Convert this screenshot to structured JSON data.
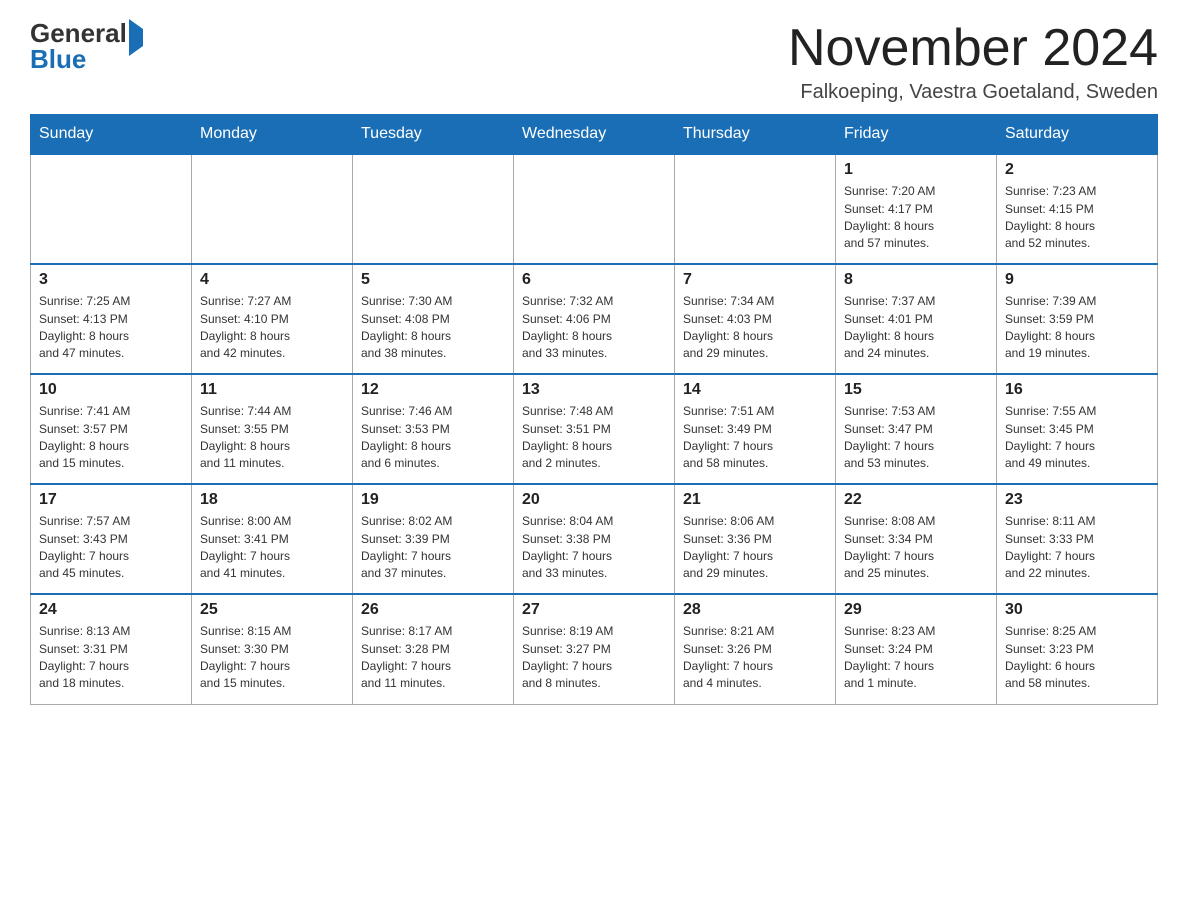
{
  "logo": {
    "general": "General",
    "blue": "Blue"
  },
  "header": {
    "month_year": "November 2024",
    "location": "Falkoeping, Vaestra Goetaland, Sweden"
  },
  "days_of_week": [
    "Sunday",
    "Monday",
    "Tuesday",
    "Wednesday",
    "Thursday",
    "Friday",
    "Saturday"
  ],
  "weeks": [
    [
      {
        "day": "",
        "info": ""
      },
      {
        "day": "",
        "info": ""
      },
      {
        "day": "",
        "info": ""
      },
      {
        "day": "",
        "info": ""
      },
      {
        "day": "",
        "info": ""
      },
      {
        "day": "1",
        "info": "Sunrise: 7:20 AM\nSunset: 4:17 PM\nDaylight: 8 hours\nand 57 minutes."
      },
      {
        "day": "2",
        "info": "Sunrise: 7:23 AM\nSunset: 4:15 PM\nDaylight: 8 hours\nand 52 minutes."
      }
    ],
    [
      {
        "day": "3",
        "info": "Sunrise: 7:25 AM\nSunset: 4:13 PM\nDaylight: 8 hours\nand 47 minutes."
      },
      {
        "day": "4",
        "info": "Sunrise: 7:27 AM\nSunset: 4:10 PM\nDaylight: 8 hours\nand 42 minutes."
      },
      {
        "day": "5",
        "info": "Sunrise: 7:30 AM\nSunset: 4:08 PM\nDaylight: 8 hours\nand 38 minutes."
      },
      {
        "day": "6",
        "info": "Sunrise: 7:32 AM\nSunset: 4:06 PM\nDaylight: 8 hours\nand 33 minutes."
      },
      {
        "day": "7",
        "info": "Sunrise: 7:34 AM\nSunset: 4:03 PM\nDaylight: 8 hours\nand 29 minutes."
      },
      {
        "day": "8",
        "info": "Sunrise: 7:37 AM\nSunset: 4:01 PM\nDaylight: 8 hours\nand 24 minutes."
      },
      {
        "day": "9",
        "info": "Sunrise: 7:39 AM\nSunset: 3:59 PM\nDaylight: 8 hours\nand 19 minutes."
      }
    ],
    [
      {
        "day": "10",
        "info": "Sunrise: 7:41 AM\nSunset: 3:57 PM\nDaylight: 8 hours\nand 15 minutes."
      },
      {
        "day": "11",
        "info": "Sunrise: 7:44 AM\nSunset: 3:55 PM\nDaylight: 8 hours\nand 11 minutes."
      },
      {
        "day": "12",
        "info": "Sunrise: 7:46 AM\nSunset: 3:53 PM\nDaylight: 8 hours\nand 6 minutes."
      },
      {
        "day": "13",
        "info": "Sunrise: 7:48 AM\nSunset: 3:51 PM\nDaylight: 8 hours\nand 2 minutes."
      },
      {
        "day": "14",
        "info": "Sunrise: 7:51 AM\nSunset: 3:49 PM\nDaylight: 7 hours\nand 58 minutes."
      },
      {
        "day": "15",
        "info": "Sunrise: 7:53 AM\nSunset: 3:47 PM\nDaylight: 7 hours\nand 53 minutes."
      },
      {
        "day": "16",
        "info": "Sunrise: 7:55 AM\nSunset: 3:45 PM\nDaylight: 7 hours\nand 49 minutes."
      }
    ],
    [
      {
        "day": "17",
        "info": "Sunrise: 7:57 AM\nSunset: 3:43 PM\nDaylight: 7 hours\nand 45 minutes."
      },
      {
        "day": "18",
        "info": "Sunrise: 8:00 AM\nSunset: 3:41 PM\nDaylight: 7 hours\nand 41 minutes."
      },
      {
        "day": "19",
        "info": "Sunrise: 8:02 AM\nSunset: 3:39 PM\nDaylight: 7 hours\nand 37 minutes."
      },
      {
        "day": "20",
        "info": "Sunrise: 8:04 AM\nSunset: 3:38 PM\nDaylight: 7 hours\nand 33 minutes."
      },
      {
        "day": "21",
        "info": "Sunrise: 8:06 AM\nSunset: 3:36 PM\nDaylight: 7 hours\nand 29 minutes."
      },
      {
        "day": "22",
        "info": "Sunrise: 8:08 AM\nSunset: 3:34 PM\nDaylight: 7 hours\nand 25 minutes."
      },
      {
        "day": "23",
        "info": "Sunrise: 8:11 AM\nSunset: 3:33 PM\nDaylight: 7 hours\nand 22 minutes."
      }
    ],
    [
      {
        "day": "24",
        "info": "Sunrise: 8:13 AM\nSunset: 3:31 PM\nDaylight: 7 hours\nand 18 minutes."
      },
      {
        "day": "25",
        "info": "Sunrise: 8:15 AM\nSunset: 3:30 PM\nDaylight: 7 hours\nand 15 minutes."
      },
      {
        "day": "26",
        "info": "Sunrise: 8:17 AM\nSunset: 3:28 PM\nDaylight: 7 hours\nand 11 minutes."
      },
      {
        "day": "27",
        "info": "Sunrise: 8:19 AM\nSunset: 3:27 PM\nDaylight: 7 hours\nand 8 minutes."
      },
      {
        "day": "28",
        "info": "Sunrise: 8:21 AM\nSunset: 3:26 PM\nDaylight: 7 hours\nand 4 minutes."
      },
      {
        "day": "29",
        "info": "Sunrise: 8:23 AM\nSunset: 3:24 PM\nDaylight: 7 hours\nand 1 minute."
      },
      {
        "day": "30",
        "info": "Sunrise: 8:25 AM\nSunset: 3:23 PM\nDaylight: 6 hours\nand 58 minutes."
      }
    ]
  ]
}
